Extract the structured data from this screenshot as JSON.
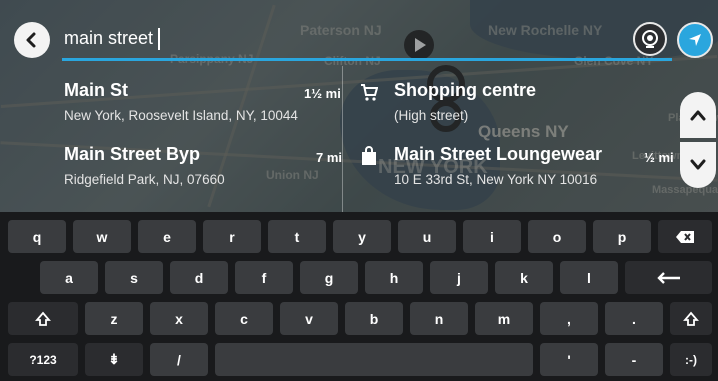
{
  "search": {
    "value": "main street"
  },
  "map": {
    "labels": [
      "Paterson NJ",
      "New Rochelle NY",
      "Parsippany NJ",
      "Clifton NJ",
      "Glen Cove NY",
      "Queens NY",
      "Union NJ",
      "NEW YORK",
      "Plainview",
      "Levittown",
      "Massapequa"
    ]
  },
  "results": [
    {
      "name": "Main St",
      "address": "New York, Roosevelt Island, NY, 10044",
      "distance": "1½ mi"
    },
    {
      "name": "Main Street Byp",
      "address": "Ridgefield Park, NJ, 07660",
      "distance": "7 mi"
    },
    {
      "name": "Shopping centre",
      "address": "(High street)",
      "distance": "",
      "icon": "shopping-cart-icon"
    },
    {
      "name": "Main Street Loungewear",
      "address": "10 E 33rd St, New York NY 10016",
      "distance": "½ mi",
      "icon": "shopping-bag-icon"
    }
  ],
  "keyboard": {
    "row1": [
      "q",
      "w",
      "e",
      "r",
      "t",
      "y",
      "u",
      "i",
      "o",
      "p"
    ],
    "row2": [
      "a",
      "s",
      "d",
      "f",
      "g",
      "h",
      "j",
      "k",
      "l"
    ],
    "row3": [
      "z",
      "x",
      "c",
      "v",
      "b",
      "n",
      "m",
      ",",
      "."
    ],
    "row1_subs": [
      "",
      "",
      "",
      "",
      "",
      "",
      "",
      "",
      "",
      ""
    ],
    "row4": {
      "symbols": "?123",
      "settings": "⇟",
      "slash": "/",
      "space": "",
      "apostrophe": "'",
      "dash": "-",
      "emoji": ":-)"
    },
    "icons": [
      "backspace-icon",
      "enter-icon",
      "shift-icon",
      "shift-icon"
    ]
  },
  "colors": {
    "accent": "#2aa6de",
    "key": "#3a3c3f",
    "keyboard_bg": "#191a1c"
  }
}
